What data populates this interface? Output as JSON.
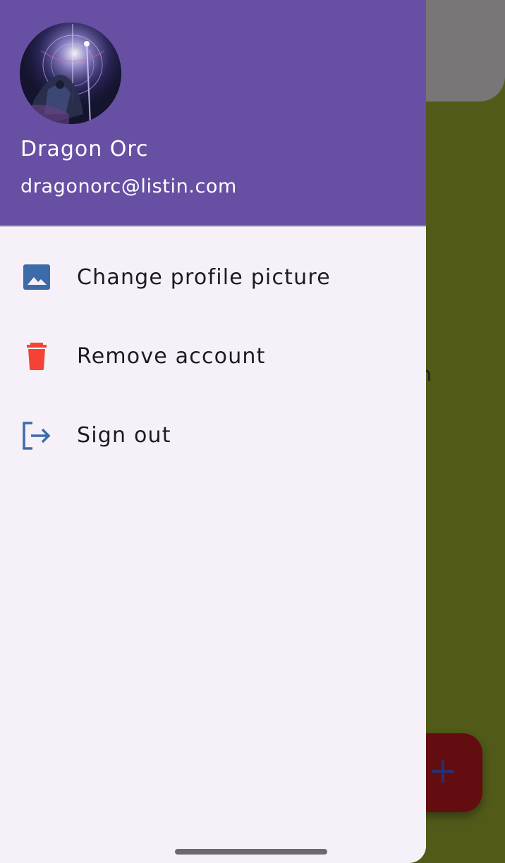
{
  "background": {
    "partial_text": "en",
    "fab_icon": "plus-icon"
  },
  "drawer": {
    "header": {
      "avatar_icon": "profile-avatar-image",
      "name": "Dragon Orc",
      "email": "dragonorc@listin.com",
      "color": "#6750a4"
    },
    "items": [
      {
        "icon": "image-icon",
        "label": "Change profile picture",
        "icon_color": "#3d6aa8"
      },
      {
        "icon": "trash-icon",
        "label": "Remove account",
        "icon_color": "#f44336"
      },
      {
        "icon": "logout-icon",
        "label": "Sign out",
        "icon_color": "#3d6aa8"
      }
    ]
  }
}
